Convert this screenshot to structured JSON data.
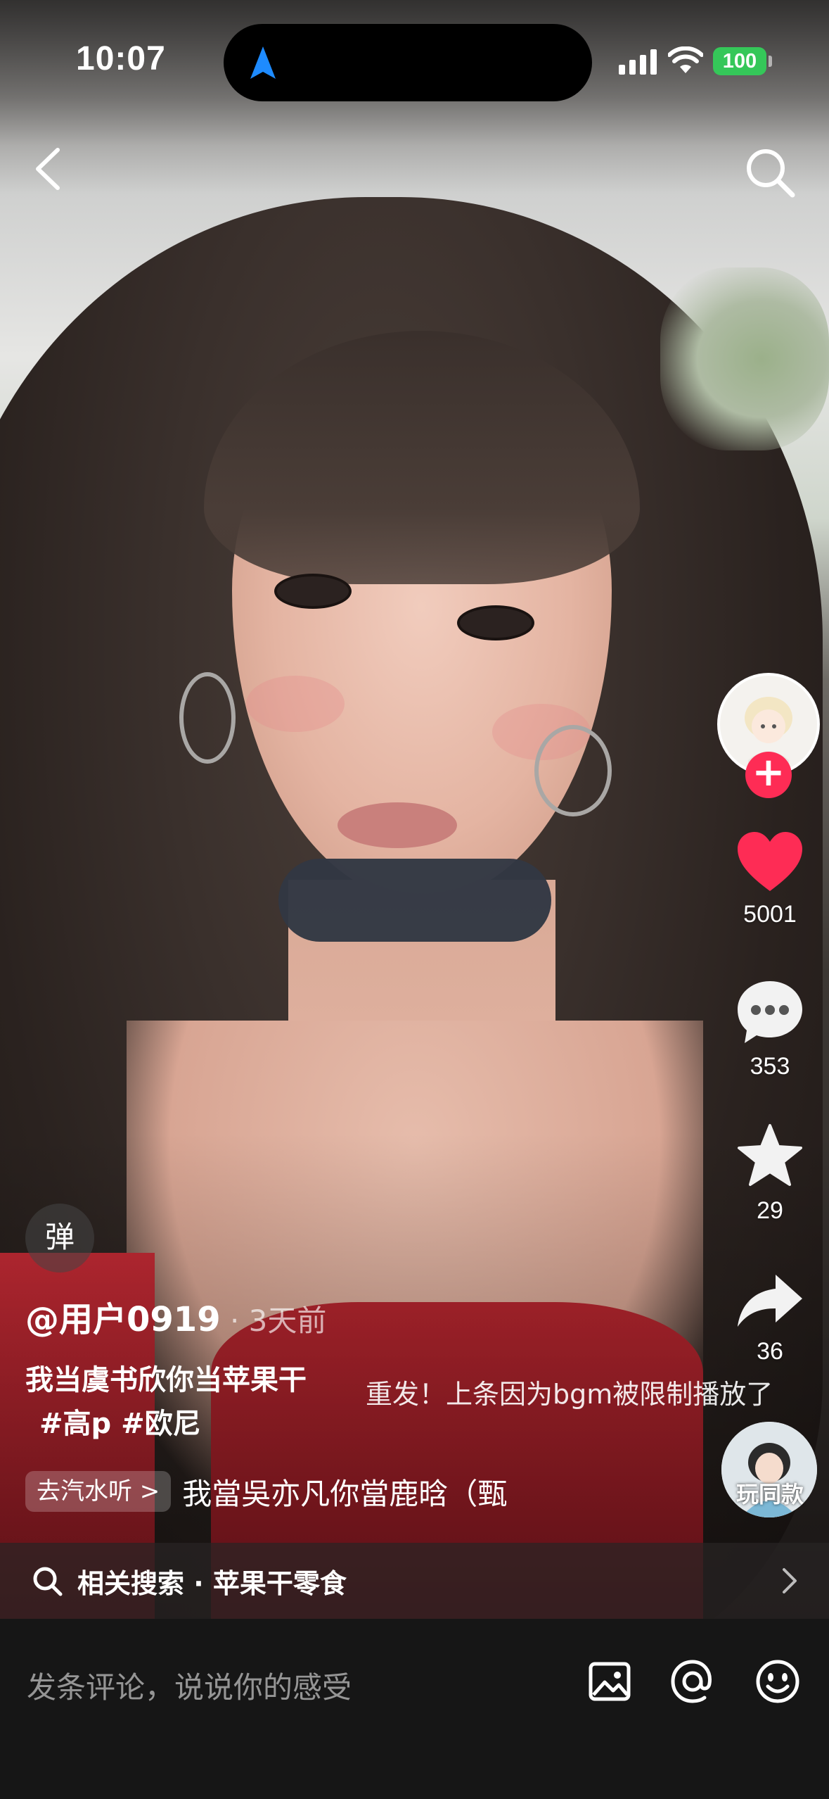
{
  "status_bar": {
    "time": "10:07",
    "battery": "100",
    "battery_color": "#35c759",
    "icons": [
      "navigation-arrow-icon",
      "signal-icon",
      "wifi-icon",
      "battery-icon"
    ]
  },
  "top_controls": {
    "icons": [
      "back-chevron-icon",
      "search-icon"
    ]
  },
  "right_rail": {
    "follow_symbol": "+",
    "like_count": "5001",
    "comment_count": "353",
    "favorite_count": "29",
    "share_count": "36",
    "music_label": "玩同款",
    "like_color": "#fe2c55"
  },
  "video_info": {
    "danmu_label": "弹",
    "author": "@用户0919",
    "separator": " · ",
    "time_ago": "3天前",
    "description": "我当虞书欣你当苹果干",
    "hashtags": " #高p #欧尼",
    "overlay_caption": "重发！上条因为bgm被限制播放了",
    "music_chip": "去汽水听 >",
    "music_title": "我當吳亦凡你當鹿晗（甄"
  },
  "related_search": {
    "label": "相关搜索 · 苹果干零食"
  },
  "comment_bar": {
    "placeholder": "发条评论，说说你的感受",
    "icons": [
      "image-icon",
      "at-mention-icon",
      "emoji-icon"
    ]
  }
}
